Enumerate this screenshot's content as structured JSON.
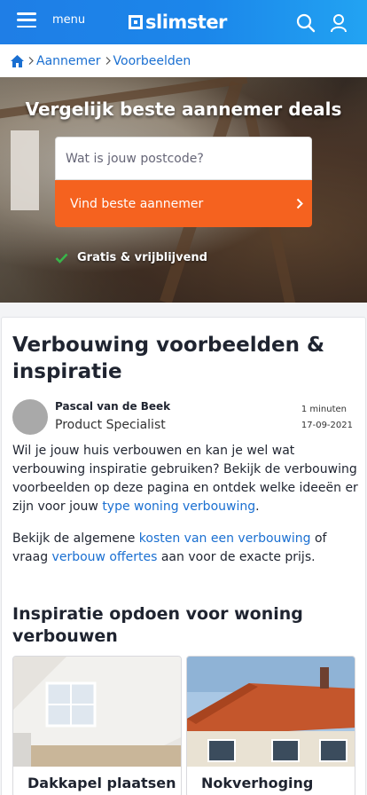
{
  "header": {
    "menu_label": "menu",
    "logo_text": "slimster",
    "accent_color": "#1f7ee6",
    "icons": [
      "hamburger-icon",
      "search-icon",
      "user-icon"
    ]
  },
  "breadcrumb": {
    "home_icon": "home-icon",
    "items": [
      "Aannemer",
      "Voorbeelden"
    ]
  },
  "hero": {
    "title": "Vergelijk beste aannemer deals",
    "postcode_placeholder": "Wat is jouw postcode?",
    "cta_label": "Vind beste aannemer",
    "cta_color": "#f5621f",
    "benefit": "Gratis & vrijblijvend"
  },
  "article": {
    "title": "Verbouwing voorbeelden & inspiratie",
    "author": "Pascal van de Beek",
    "role": "Product Specialist",
    "read_time": "1 minuten",
    "date": "17-09-2021",
    "intro": {
      "text": "Wil je jouw huis verbouwen en kan je wel wat verbouwing inspiratie gebruiken? Bekijk de verbouwing voorbeelden op deze pagina en ontdek welke ideeën er zijn voor jouw ",
      "link": "type woning verbouwing",
      "end": "."
    },
    "costs": {
      "text_before": "Bekijk de algemene ",
      "link1": "kosten van een verbouwing",
      "text_middle": " of vraag ",
      "link2": "verbouw offertes",
      "text_after": " aan voor de exacte prijs."
    },
    "section_heading": "Inspiratie opdoen voor woning verbouwen",
    "cards": [
      {
        "label": "Dakkapel plaatsen"
      },
      {
        "label": "Nokverhoging"
      }
    ]
  }
}
